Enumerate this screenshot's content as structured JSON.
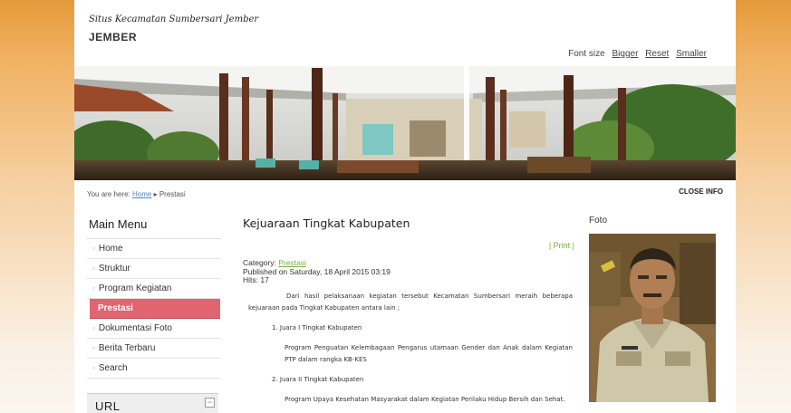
{
  "header": {
    "slogan": "Situs Kecamatan Sumbersari Jember",
    "site_name": "JEMBER",
    "font_size_label": "Font size",
    "bigger": "Bigger",
    "reset": "Reset",
    "smaller": "Smaller"
  },
  "breadcrumb": {
    "prefix": "You are here:",
    "home": "Home",
    "separator": "▸",
    "current": "Prestasi"
  },
  "close_info": "CLOSE INFO",
  "sidebar": {
    "title": "Main Menu",
    "items": [
      {
        "label": "Home",
        "active": false
      },
      {
        "label": "Struktur",
        "active": false
      },
      {
        "label": "Program Kegiatan",
        "active": false
      },
      {
        "label": "Prestasi",
        "active": true
      },
      {
        "label": "Dokumentasi Foto",
        "active": false
      },
      {
        "label": "Berita Terbaru",
        "active": false
      },
      {
        "label": "Search",
        "active": false
      }
    ],
    "url_box_title": "URL",
    "url_box_toggle": "−"
  },
  "article": {
    "title": "Kejuaraan Tingkat Kabupaten",
    "print": "| Print |",
    "category_label": "Category:",
    "category": "Prestasi",
    "published": "Published on Saturday, 18 April 2015 03:19",
    "hits": "Hits: 17",
    "intro": "Dari hasil pelaksanaan kegiatan tersebut Kecamatan Sumbersari meraih beberapa kejuaraan pada Tingkat Kabupaten antara lain ;",
    "item1": "1. Juara I Tingkat Kabupaten",
    "desc1": "Program Penguatan Kelembagaan Pengarus utamaan Gender dan Anak dalam Kegiatan PTP dalam rangka KB-KES",
    "item2": "2. Juara II Tingkat Kabupaten",
    "desc2": "Program Upaya Kesehatan Masyarakat dalam Kegiatan Perilaku Hidup Bersih dan Sehat."
  },
  "foto": {
    "title": "Foto"
  }
}
